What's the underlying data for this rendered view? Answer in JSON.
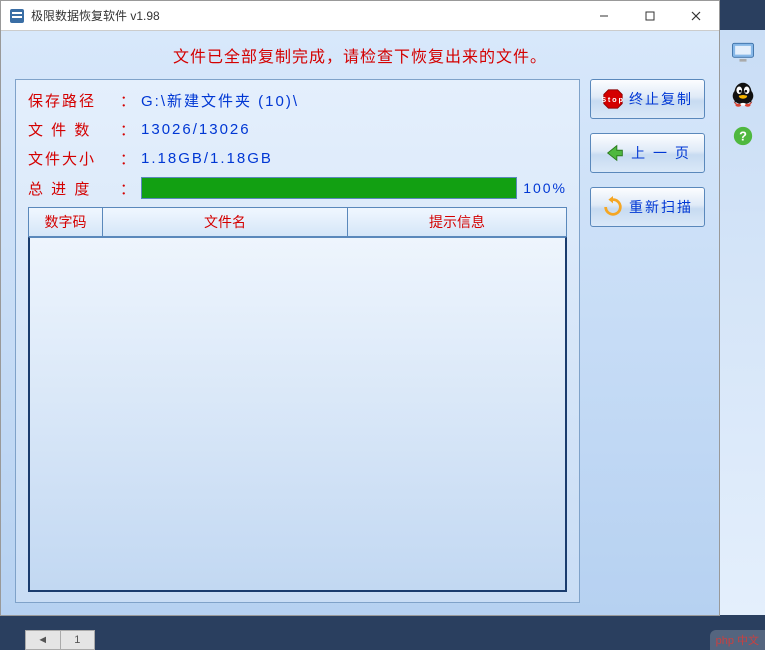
{
  "window": {
    "title": "极限数据恢复软件 v1.98"
  },
  "status_message": "文件已全部复制完成，请检查下恢复出来的文件。",
  "info": {
    "save_path_label": "保存路径",
    "save_path_value": "G:\\新建文件夹 (10)\\",
    "file_count_label": "文 件 数",
    "file_count_value": "13026/13026",
    "file_size_label": "文件大小",
    "file_size_value": "1.18GB/1.18GB",
    "progress_label": "总 进 度",
    "progress_pct": "100%",
    "colon": "："
  },
  "table": {
    "headers": [
      "数字码",
      "文件名",
      "提示信息"
    ]
  },
  "buttons": {
    "stop": "终止复制",
    "prev": "上 一 页",
    "rescan": "重新扫描"
  },
  "tabs": {
    "t1": "1"
  },
  "watermark": "php 中文",
  "colors": {
    "accent_red": "#d40000",
    "accent_blue": "#0037d4",
    "progress_green": "#12a012"
  }
}
